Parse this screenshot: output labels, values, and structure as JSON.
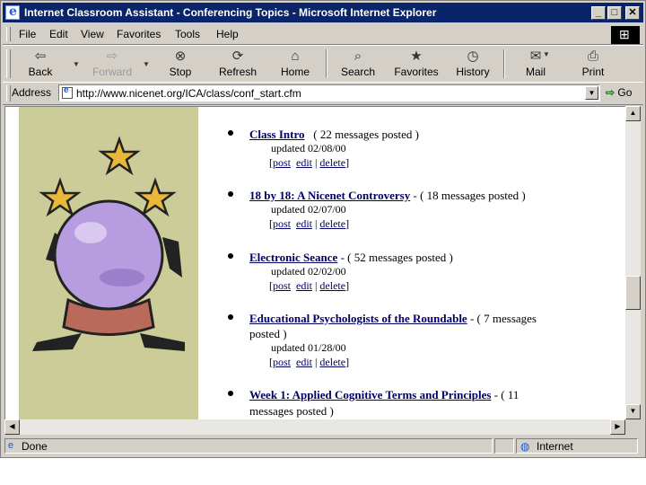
{
  "window": {
    "title": "Internet Classroom Assistant - Conferencing Topics - Microsoft Internet Explorer",
    "controls": {
      "minimize": "_",
      "maximize": "□",
      "close": "✕"
    }
  },
  "menu": {
    "items": [
      {
        "label": "File"
      },
      {
        "label": "Edit"
      },
      {
        "label": "View"
      },
      {
        "label": "Favorites"
      },
      {
        "label": "Tools"
      },
      {
        "label": "Help"
      }
    ]
  },
  "toolbar": {
    "back": {
      "label": "Back",
      "icon": "⇦"
    },
    "forward": {
      "label": "Forward",
      "icon": "⇨"
    },
    "stop": {
      "label": "Stop",
      "icon": "⊗"
    },
    "refresh": {
      "label": "Refresh",
      "icon": "⟳"
    },
    "home": {
      "label": "Home",
      "icon": "⌂"
    },
    "search": {
      "label": "Search",
      "icon": "⌕"
    },
    "favorites": {
      "label": "Favorites",
      "icon": "★"
    },
    "history": {
      "label": "History",
      "icon": "◷"
    },
    "mail": {
      "label": "Mail",
      "icon": "✉"
    },
    "print": {
      "label": "Print",
      "icon": "⎙"
    },
    "dropdown_glyph": "▼"
  },
  "address": {
    "label": "Address",
    "url": "http://www.nicenet.org/ICA/class/conf_start.cfm",
    "go_label": "Go",
    "go_glyph": "⇨"
  },
  "topics": [
    {
      "title": "Class Intro",
      "sep": "",
      "count_line1": "( 22 messages posted )",
      "count_line2": "",
      "updated": "updated 02/08/00"
    },
    {
      "title": "18 by 18: A Nicenet Controversy",
      "sep": " - ",
      "count_line1": "( 18 messages posted )",
      "count_line2": "",
      "updated": "updated 02/07/00"
    },
    {
      "title": "Electronic Seance",
      "sep": " - ",
      "count_line1": "( 52 messages posted )",
      "count_line2": "",
      "updated": "updated 02/02/00"
    },
    {
      "title": "Educational Psychologists of the Roundable",
      "sep": " - ",
      "count_line1": "( 7 messages",
      "count_line2": "posted )",
      "updated": "updated 01/28/00"
    },
    {
      "title": "Week 1: Applied Cognitive Terms and Principles",
      "sep": " - ",
      "count_line1": "( 11",
      "count_line2": "messages posted )",
      "updated": ""
    }
  ],
  "topic_actions": {
    "open": "[",
    "post": "post",
    "edit": "edit",
    "divider": "|",
    "delete": "delete",
    "close": "]"
  },
  "status": {
    "text": "Done",
    "zone": "Internet"
  },
  "scroll": {
    "up": "▲",
    "down": "▼",
    "left": "◀",
    "right": "▶",
    "vertical_position": 0.62
  },
  "colors": {
    "title_bar": "#0a246a",
    "link": "#000066",
    "sidebar_bg": "#cccc99",
    "chrome": "#d4d0c8"
  }
}
